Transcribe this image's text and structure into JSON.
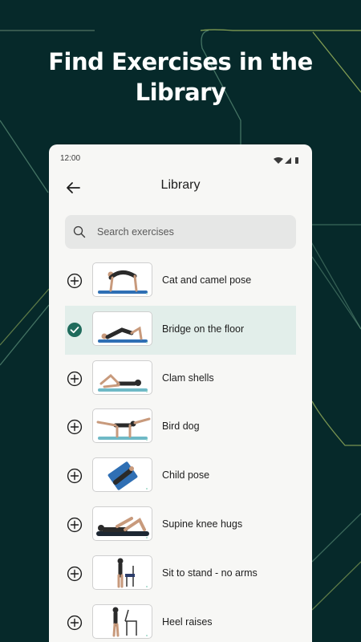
{
  "headline": "Find Exercises in the Library",
  "status_bar": {
    "time": "12:00"
  },
  "app_bar": {
    "title": "Library"
  },
  "search": {
    "placeholder": "Search exercises"
  },
  "exercises": [
    {
      "label": "Cat and camel pose",
      "selected": false,
      "figure": "cat"
    },
    {
      "label": "Bridge on the floor",
      "selected": true,
      "figure": "bridge"
    },
    {
      "label": "Clam shells",
      "selected": false,
      "figure": "clam"
    },
    {
      "label": "Bird dog",
      "selected": false,
      "figure": "birddog"
    },
    {
      "label": "Child pose",
      "selected": false,
      "figure": "child"
    },
    {
      "label": "Supine knee hugs",
      "selected": false,
      "figure": "kneehug"
    },
    {
      "label": "Sit to stand - no arms",
      "selected": false,
      "figure": "sitstand"
    },
    {
      "label": "Heel raises",
      "selected": false,
      "figure": "heel"
    }
  ],
  "colors": {
    "background": "#06292a",
    "accent": "#1f6b5c",
    "selected_row": "#e2eeea",
    "mat": "#2f6fb4"
  }
}
